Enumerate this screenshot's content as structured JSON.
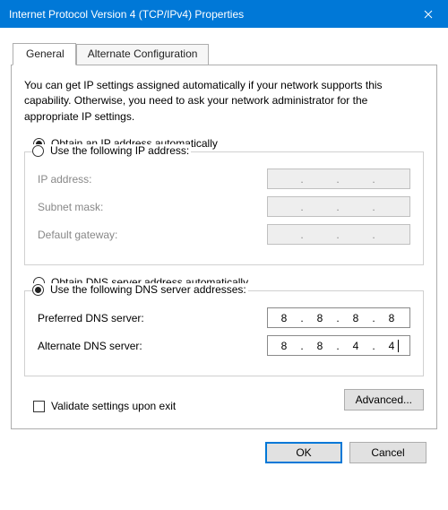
{
  "window": {
    "title": "Internet Protocol Version 4 (TCP/IPv4) Properties"
  },
  "tabs": {
    "general": "General",
    "alternate": "Alternate Configuration"
  },
  "description": "You can get IP settings assigned automatically if your network supports this capability. Otherwise, you need to ask your network administrator for the appropriate IP settings.",
  "ip": {
    "auto_label": "Obtain an IP address automatically",
    "manual_label": "Use the following IP address:",
    "selected": "auto",
    "fields": {
      "address_label": "IP address:",
      "subnet_label": "Subnet mask:",
      "gateway_label": "Default gateway:",
      "address": [
        "",
        "",
        "",
        ""
      ],
      "subnet": [
        "",
        "",
        "",
        ""
      ],
      "gateway": [
        "",
        "",
        "",
        ""
      ]
    }
  },
  "dns": {
    "auto_label": "Obtain DNS server address automatically",
    "manual_label": "Use the following DNS server addresses:",
    "selected": "manual",
    "fields": {
      "preferred_label": "Preferred DNS server:",
      "alternate_label": "Alternate DNS server:",
      "preferred": [
        "8",
        "8",
        "8",
        "8"
      ],
      "alternate": [
        "8",
        "8",
        "4",
        "4"
      ]
    }
  },
  "validate_label": "Validate settings upon exit",
  "validate_checked": false,
  "buttons": {
    "advanced": "Advanced...",
    "ok": "OK",
    "cancel": "Cancel"
  }
}
